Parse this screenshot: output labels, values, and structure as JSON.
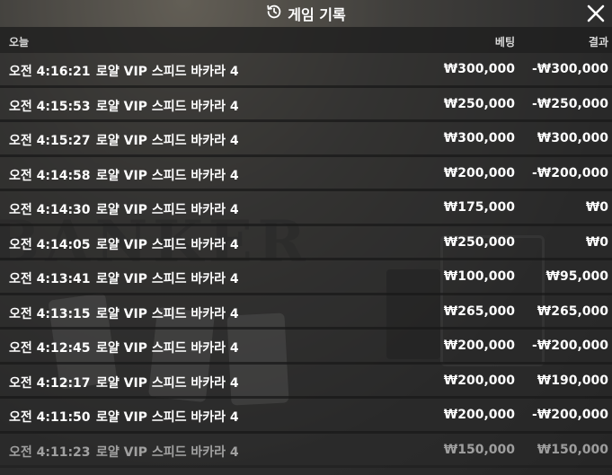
{
  "window": {
    "title": "게임 기록",
    "title_icon": "history-icon",
    "close_icon": "close-icon"
  },
  "header": {
    "day": "오늘",
    "bet_label": "베팅",
    "result_label": "결과"
  },
  "rows": [
    {
      "time": "오전 4:16:21",
      "game": "로얄 VIP 스피드 바카라 4",
      "bet": "₩300,000",
      "result": "-₩300,000"
    },
    {
      "time": "오전 4:15:53",
      "game": "로얄 VIP 스피드 바카라 4",
      "bet": "₩250,000",
      "result": "-₩250,000"
    },
    {
      "time": "오전 4:15:27",
      "game": "로얄 VIP 스피드 바카라 4",
      "bet": "₩300,000",
      "result": "₩300,000"
    },
    {
      "time": "오전 4:14:58",
      "game": "로얄 VIP 스피드 바카라 4",
      "bet": "₩200,000",
      "result": "-₩200,000"
    },
    {
      "time": "오전 4:14:30",
      "game": "로얄 VIP 스피드 바카라 4",
      "bet": "₩175,000",
      "result": "₩0"
    },
    {
      "time": "오전 4:14:05",
      "game": "로얄 VIP 스피드 바카라 4",
      "bet": "₩250,000",
      "result": "₩0"
    },
    {
      "time": "오전 4:13:41",
      "game": "로얄 VIP 스피드 바카라 4",
      "bet": "₩100,000",
      "result": "₩95,000"
    },
    {
      "time": "오전 4:13:15",
      "game": "로얄 VIP 스피드 바카라 4",
      "bet": "₩265,000",
      "result": "₩265,000"
    },
    {
      "time": "오전 4:12:45",
      "game": "로얄 VIP 스피드 바카라 4",
      "bet": "₩200,000",
      "result": "-₩200,000"
    },
    {
      "time": "오전 4:12:17",
      "game": "로얄 VIP 스피드 바카라 4",
      "bet": "₩200,000",
      "result": "₩190,000"
    },
    {
      "time": "오전 4:11:50",
      "game": "로얄 VIP 스피드 바카라 4",
      "bet": "₩200,000",
      "result": "-₩200,000"
    },
    {
      "time": "오전 4:11:23",
      "game": "로얄 VIP 스피드 바카라 4",
      "bet": "₩150,000",
      "result": "₩150,000"
    }
  ]
}
